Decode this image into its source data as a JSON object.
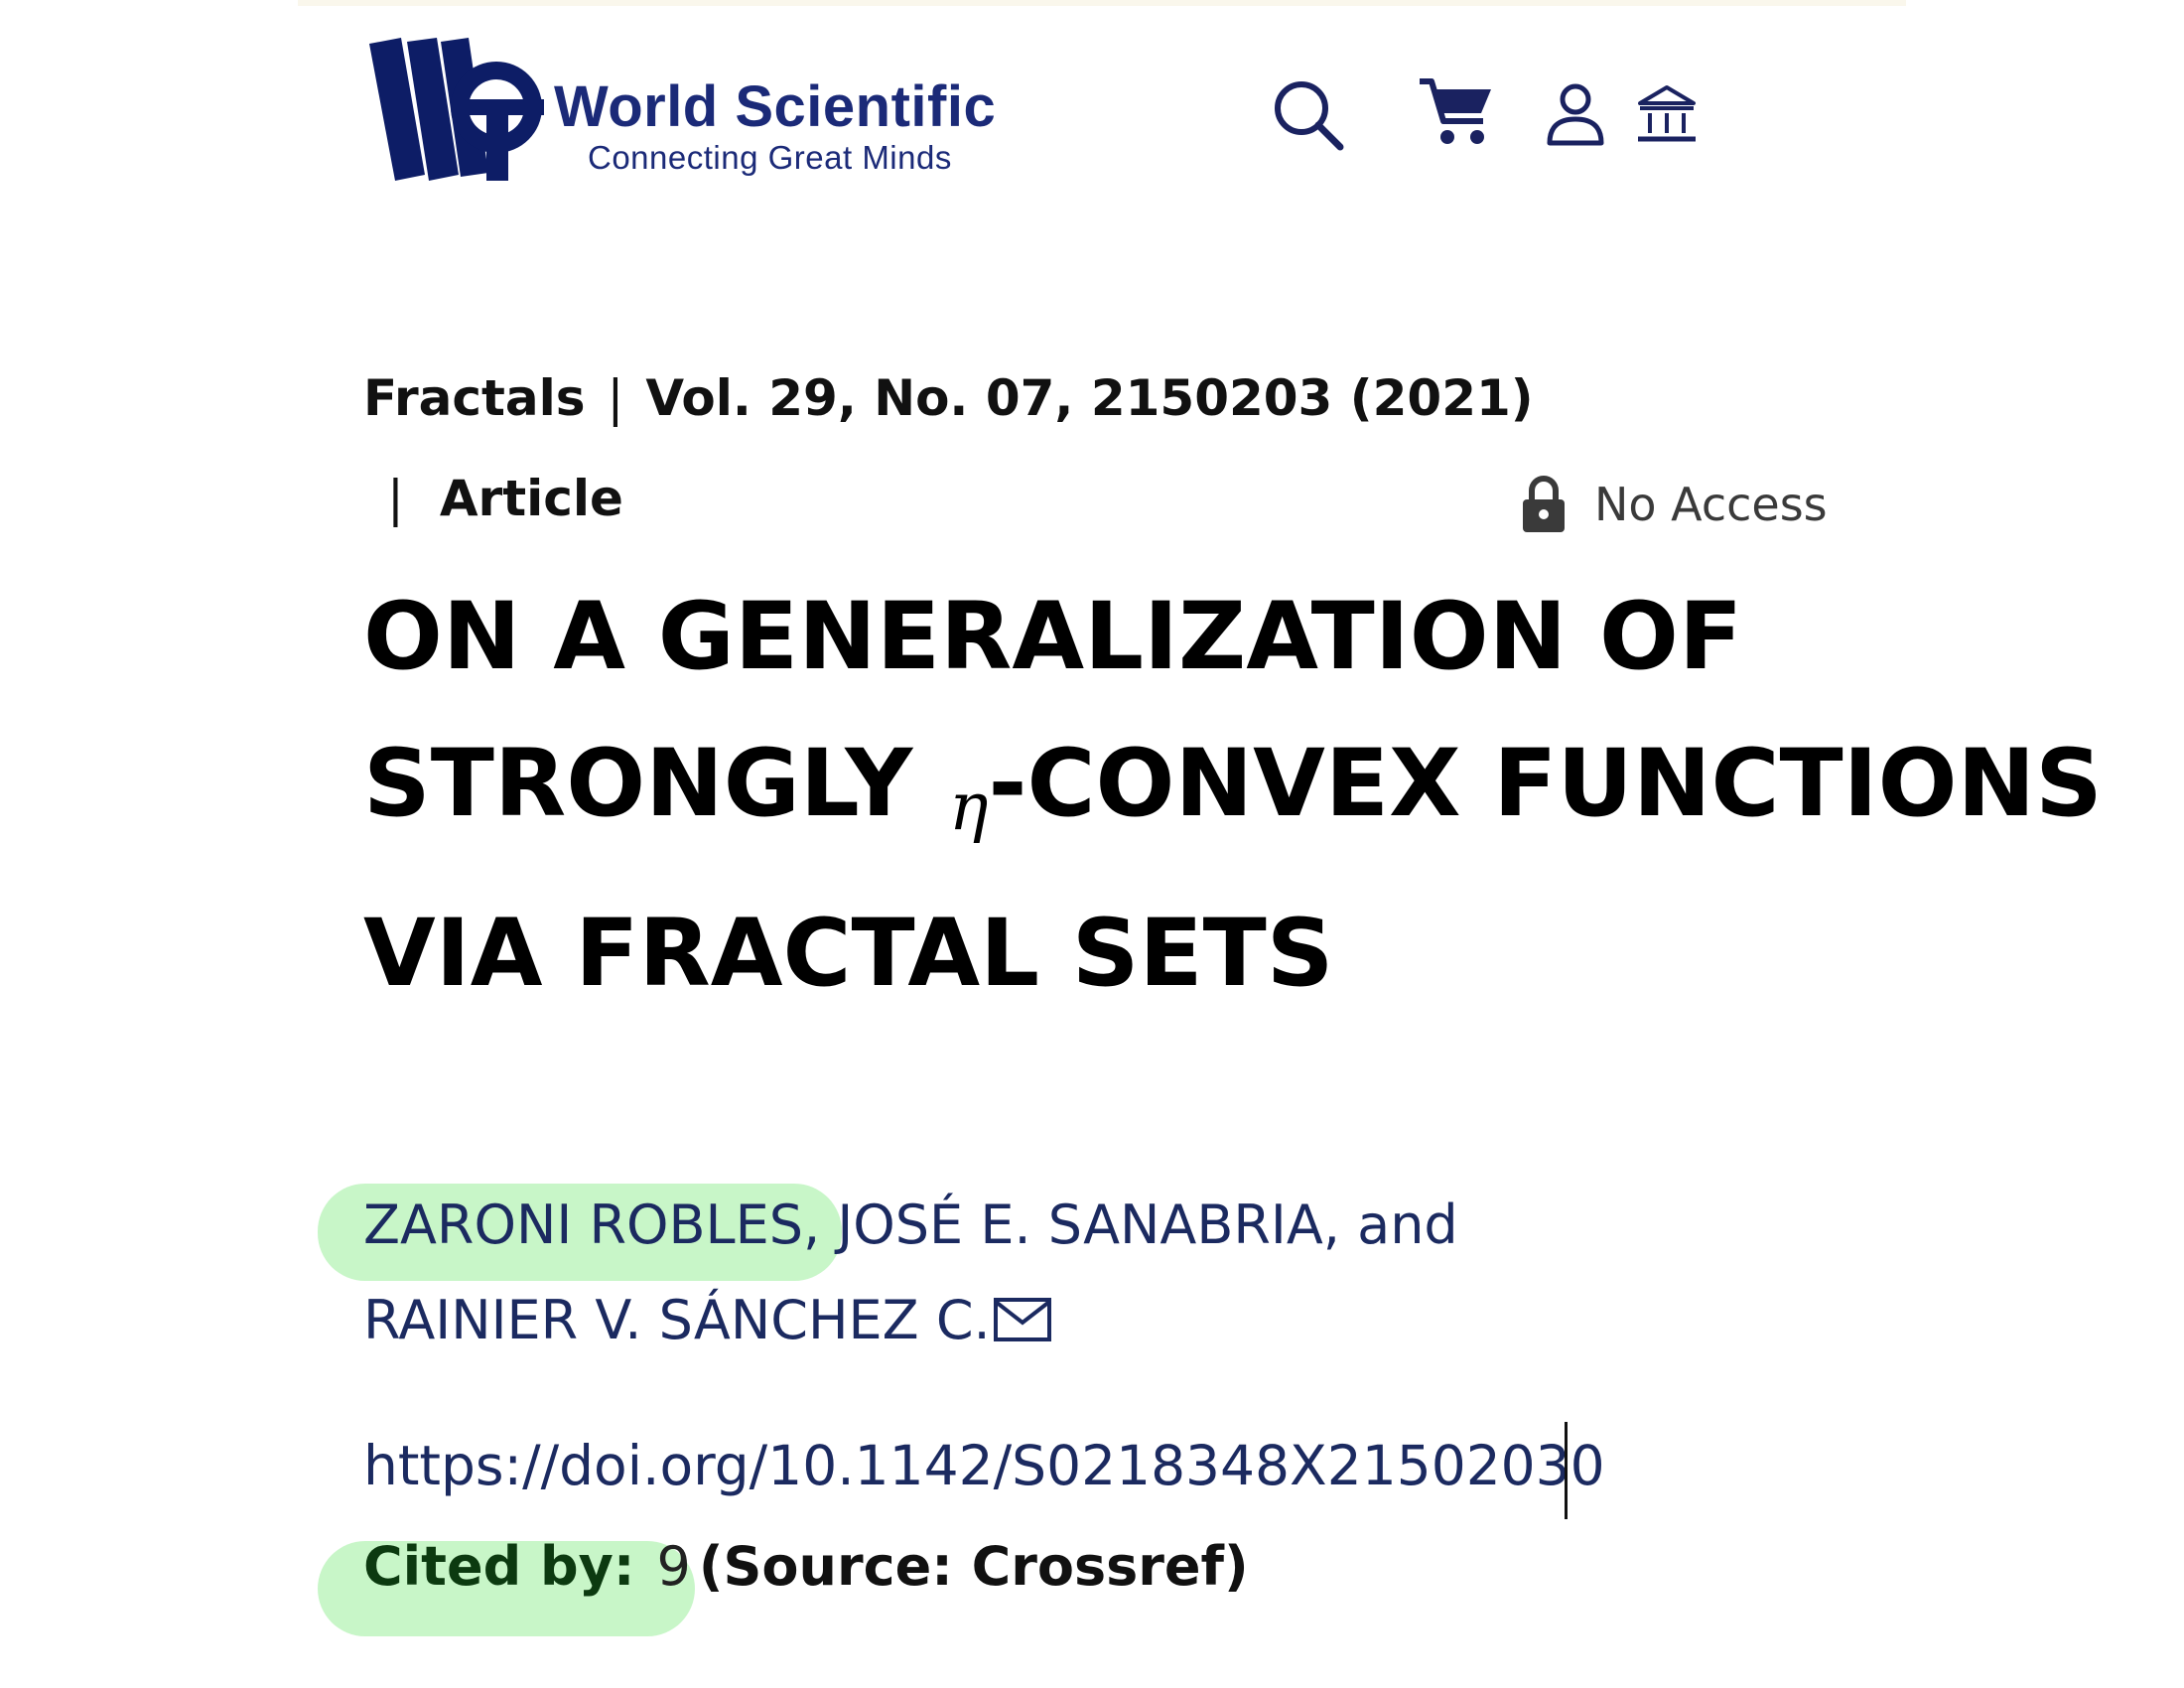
{
  "header": {
    "logo_name": "World Scientific",
    "logo_tagline": "Connecting Great Minds",
    "icons": [
      "search-icon",
      "cart-icon",
      "user-icon",
      "institution-icon"
    ],
    "brand_color": "#1b2a78"
  },
  "article": {
    "journal": "Fractals",
    "issue": "Vol. 29, No. 07, 2150203 (2021)",
    "separator": "|",
    "type": "Article",
    "access_label": "No Access",
    "title_part1": "ON A GENERALIZATION OF STRONGLY ",
    "title_symbol": "η",
    "title_part2": "-CONVEX FUNCTIONS VIA FRACTAL SETS",
    "authors": [
      "ZARONI ROBLES",
      "JOSÉ E. SANABRIA",
      "RAINIER V. SÁNCHEZ C."
    ],
    "author_sep": ", ",
    "author_and": ", and ",
    "doi": "https://doi.org/10.1142/S0218348X21502030",
    "cited_label": "Cited by:",
    "cited_count": "9",
    "cited_source": "(Source: Crossref)",
    "highlight_color": "#c2f5c2"
  }
}
